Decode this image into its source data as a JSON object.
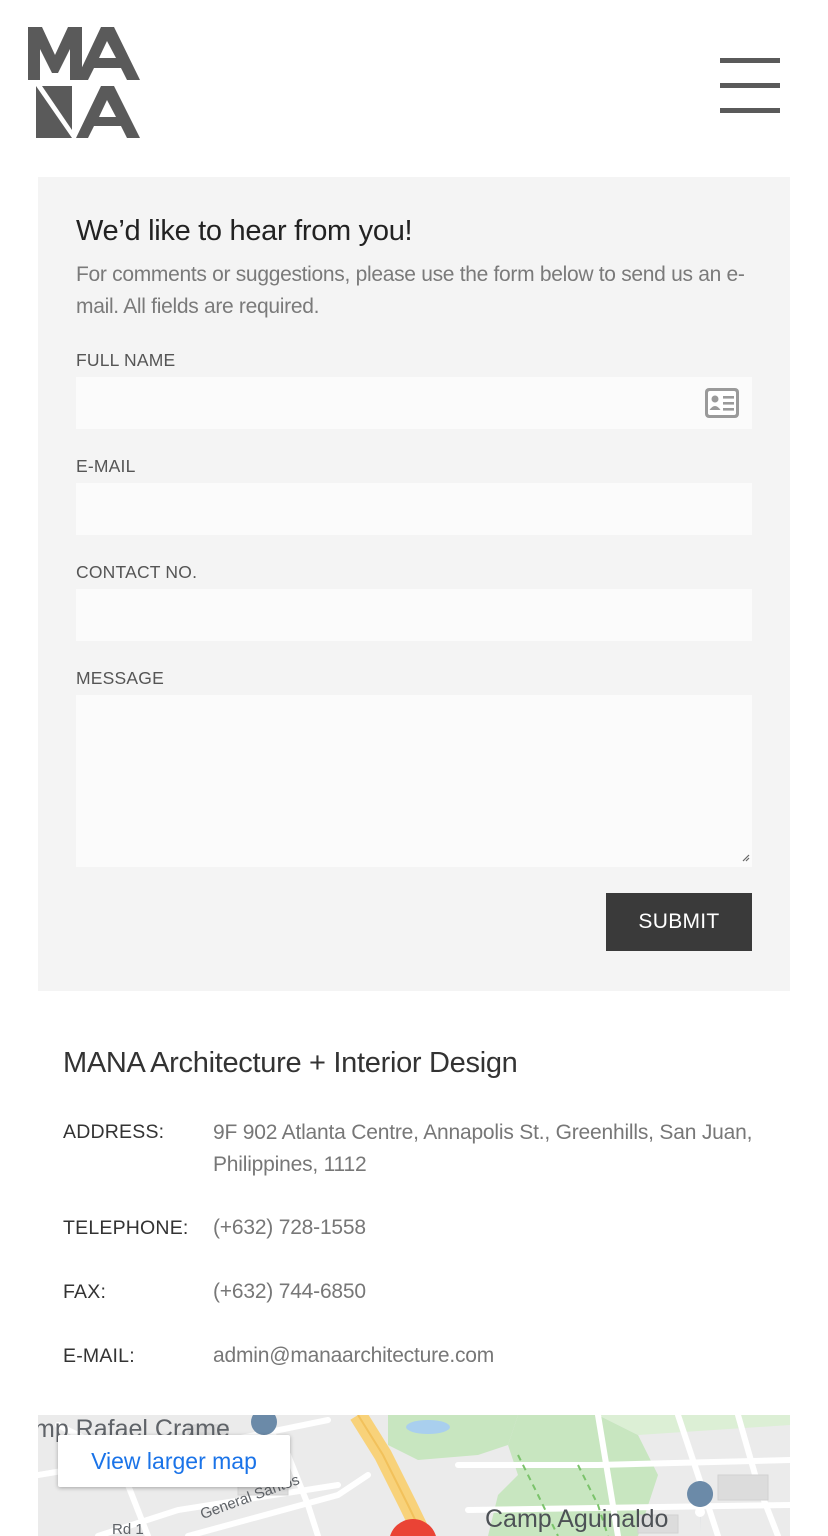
{
  "header": {
    "logo_text": "MANA",
    "menu_icon": "hamburger-menu-icon"
  },
  "form": {
    "title": "We’d like to hear from you!",
    "intro": "For comments or suggestions, please use the form below to send us an e-mail. All fields are required.",
    "fields": {
      "full_name": {
        "label": "FULL NAME",
        "value": "",
        "icon": "contact-card-icon"
      },
      "email": {
        "label": "E-MAIL",
        "value": ""
      },
      "contact_no": {
        "label": "CONTACT NO.",
        "value": ""
      },
      "message": {
        "label": "MESSAGE",
        "value": ""
      }
    },
    "submit_label": "SUBMIT"
  },
  "company": {
    "name": "MANA Architecture + Interior Design",
    "details": [
      {
        "label": "ADDRESS:",
        "value": "9F 902 Atlanta Centre, Annapolis St., Greenhills, San Juan, Philippines, 1112"
      },
      {
        "label": "TELEPHONE:",
        "value": "(+632) 728-1558"
      },
      {
        "label": "FAX:",
        "value": "(+632) 744-6850"
      },
      {
        "label": "E-MAIL:",
        "value": "admin@manaarchitecture.com"
      }
    ]
  },
  "map": {
    "button_label": "View larger map",
    "labels": {
      "place_top_left": "mp Rafael Crame",
      "street": "General Santos",
      "road": "Rd 1",
      "landmark": "Camp Aguinaldo"
    }
  },
  "colors": {
    "panel_bg": "#f4f4f4",
    "input_bg": "#fbfbfb",
    "button_bg": "#3a3a3a",
    "logo": "#5a5a5a",
    "map_link": "#1a73e8"
  }
}
